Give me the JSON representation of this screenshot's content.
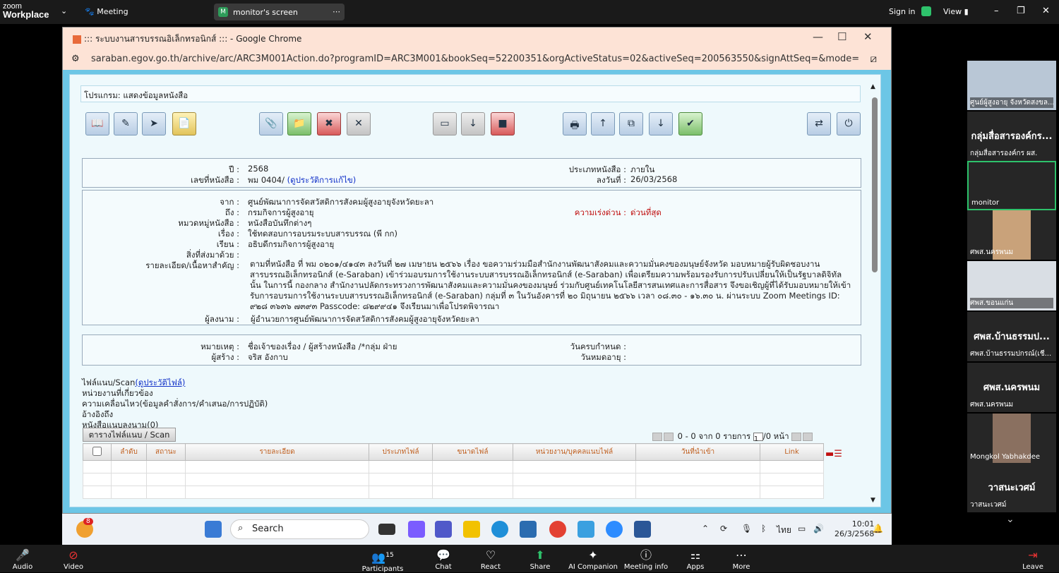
{
  "zoom": {
    "brand_top": "zoom",
    "brand": "Workplace",
    "meeting": "Meeting",
    "share_tab": "monitor's screen",
    "signin": "Sign in",
    "view": "View"
  },
  "chrome": {
    "title": "::: ระบบงานสารบรรณอิเล็กทรอนิกส์ ::: - Google Chrome",
    "url": "saraban.egov.go.th/archive/arc/ARC3M001Action.do?programID=ARC3M001&bookSeq=52200351&orgActiveStatus=02&activeSeq=200563550&signAttSeq=&mode="
  },
  "page": {
    "program": "โปรแกรม: แสดงข้อมูลหนังสือ",
    "year_label": "ปี :",
    "year": "2568",
    "docno_label": "เลขที่หนังสือ :",
    "docno": "พม 0404/",
    "history_link": "(ดูประวัติการแก้ไข)",
    "doctype_label": "ประเภทหนังสือ :",
    "doctype": "ภายใน",
    "date_label": "ลงวันที่ :",
    "date": "26/03/2568",
    "from_label": "จาก :",
    "from": "ศูนย์พัฒนาการจัดสวัสดิการสังคมผู้สูงอายุจังหวัดยะลา",
    "to_label": "ถึง :",
    "to": "กรมกิจการผู้สูงอายุ",
    "urgency_label": "ความเร่งด่วน :",
    "urgency": "ด่วนที่สุด",
    "category_label": "หมวดหมู่หนังสือ :",
    "category": "หนังสือบันทึกต่างๆ",
    "subject_label": "เรื่อง :",
    "subject": "ใช้ทดสอบการอบรมระบบสารบรรณ (พี กก)",
    "dear_label": "เรียน :",
    "dear": "อธิบดีกรมกิจการผู้สูงอายุ",
    "enclosure_label": "สิ่งที่ส่งมาด้วย :",
    "detail_label": "รายละเอียด/เนื้อหาสำคัญ :",
    "detail": "ตามที่หนังสือ ที่ พม ๐๒๐๑/๔๑๔๓ ลงวันที่ ๒๗ เมษายน ๒๕๖๖ เรื่อง ขอความร่วมมือสำนักงานพัฒนาสังคมและความมั่นคงของมนุษย์จังหวัด มอบหมายผู้รับผิดชอบงานสารบรรณอิเล็กทรอนิกส์ (e-Saraban) เข้าร่วมอบรมการใช้งานระบบสารบรรณอิเล็กทรอนิกส์ (e-Saraban) เพื่อเตรียมความพร้อมรองรับการปรับเปลี่ยนให้เป็นรัฐบาลดิจิทัล นั้น ในการนี้ กองกลาง สำนักงานปลัดกระทรวงการพัฒนาสังคมและความมั่นคงของมนุษย์ ร่วมกับศูนย์เทคโนโลยีสารสนเทศและการสื่อสาร จึงขอเชิญผู้ที่ได้รับมอบหมายให้เข้ารับการอบรมการใช้งานระบบสารบรรณอิเล็กทรอนิกส์ (e-Saraban) กลุ่มที่ ๓ ในวันอังคารที่ ๒๐ มิถุนายน ๒๕๖๖ เวลา ๐๘.๓๐ - ๑๖.๓๐ น. ผ่านระบบ Zoom Meetings ID: ๙๒๘ ๓๖๓๖ ๗๓๙๓ Passcode: ๘๒๙๙๔๑ จึงเรียนมาเพื่อโปรดพิจารณา",
    "signer_label": "ผู้ลงนาม :",
    "signer": "ผู้อำนวยการศูนย์พัฒนาการจัดสวัสดิการสังคมผู้สูงอายุจังหวัดยะลา",
    "note_label": "หมายเหตุ :",
    "note": "ชื่อเจ้าของเรื่อง / ผู้สร้างหนังสือ /*กลุ่ม ฝ่าย",
    "creator_label": "ผู้สร้าง :",
    "creator": "จริส อังกาบ",
    "due_label": "วันครบกำหนด :",
    "expire_label": "วันหมดอายุ :",
    "attach_label": "ไฟล์แนบ/Scan",
    "attach_link": "(ดูประวัติไฟล์)",
    "related": "หน่วยงานที่เกี่ยวข้อง",
    "movement": "ความเคลื่อนไหว(ข้อมูลคำสั่งการ/คำเสนอ/การปฏิบัติ)",
    "refer": "อ้างอิงถึง",
    "attach_docs": "หนังสือแนบลงนาม(0)",
    "tab": "ตารางไฟล์แนบ / Scan",
    "pager_a": "0 - 0 จาก 0 รายการ",
    "pager_page": "1",
    "pager_b": "/0 หน้า",
    "columns": [
      "ลำดับ",
      "สถานะ",
      "รายละเอียด",
      "ประเภทไฟล์",
      "ขนาดไฟล์",
      "หน่วยงาน/บุคคลแนบไฟล์",
      "วันที่นำเข้า",
      "Link"
    ]
  },
  "taskbar": {
    "search": "Search",
    "lang": "ไทย",
    "time": "10:01",
    "date": "26/3/2568",
    "badge": "8"
  },
  "participants": [
    {
      "name": "ศูนย์ผู้สูงอายุ จังหวัดสงขล..."
    },
    {
      "name": "กลุ่มสื่อสารองค์กร ผส.",
      "big": "กลุ่มสื่อสารองค์กร..."
    },
    {
      "name": "monitor"
    },
    {
      "name": "ศพส.นครพนม"
    },
    {
      "name": "ศพส.ขอนแก่น"
    },
    {
      "name": "ศพส.บ้านธรรมปกรณ์(เชี...",
      "big": "ศพส.บ้านธรรมป..."
    },
    {
      "name": "ศพส.นครพนม",
      "big": "ศพส.นครพนม"
    },
    {
      "name": "Mongkol Yabhakdee"
    },
    {
      "name": "วาสนะเวศม์",
      "big": "วาสนะเวศม์"
    }
  ],
  "bottom": {
    "audio": "Audio",
    "video": "Video",
    "participants": "Participants",
    "count": "15",
    "chat": "Chat",
    "react": "React",
    "share": "Share",
    "ai": "AI Companion",
    "info": "Meeting info",
    "apps": "Apps",
    "more": "More",
    "leave": "Leave"
  }
}
